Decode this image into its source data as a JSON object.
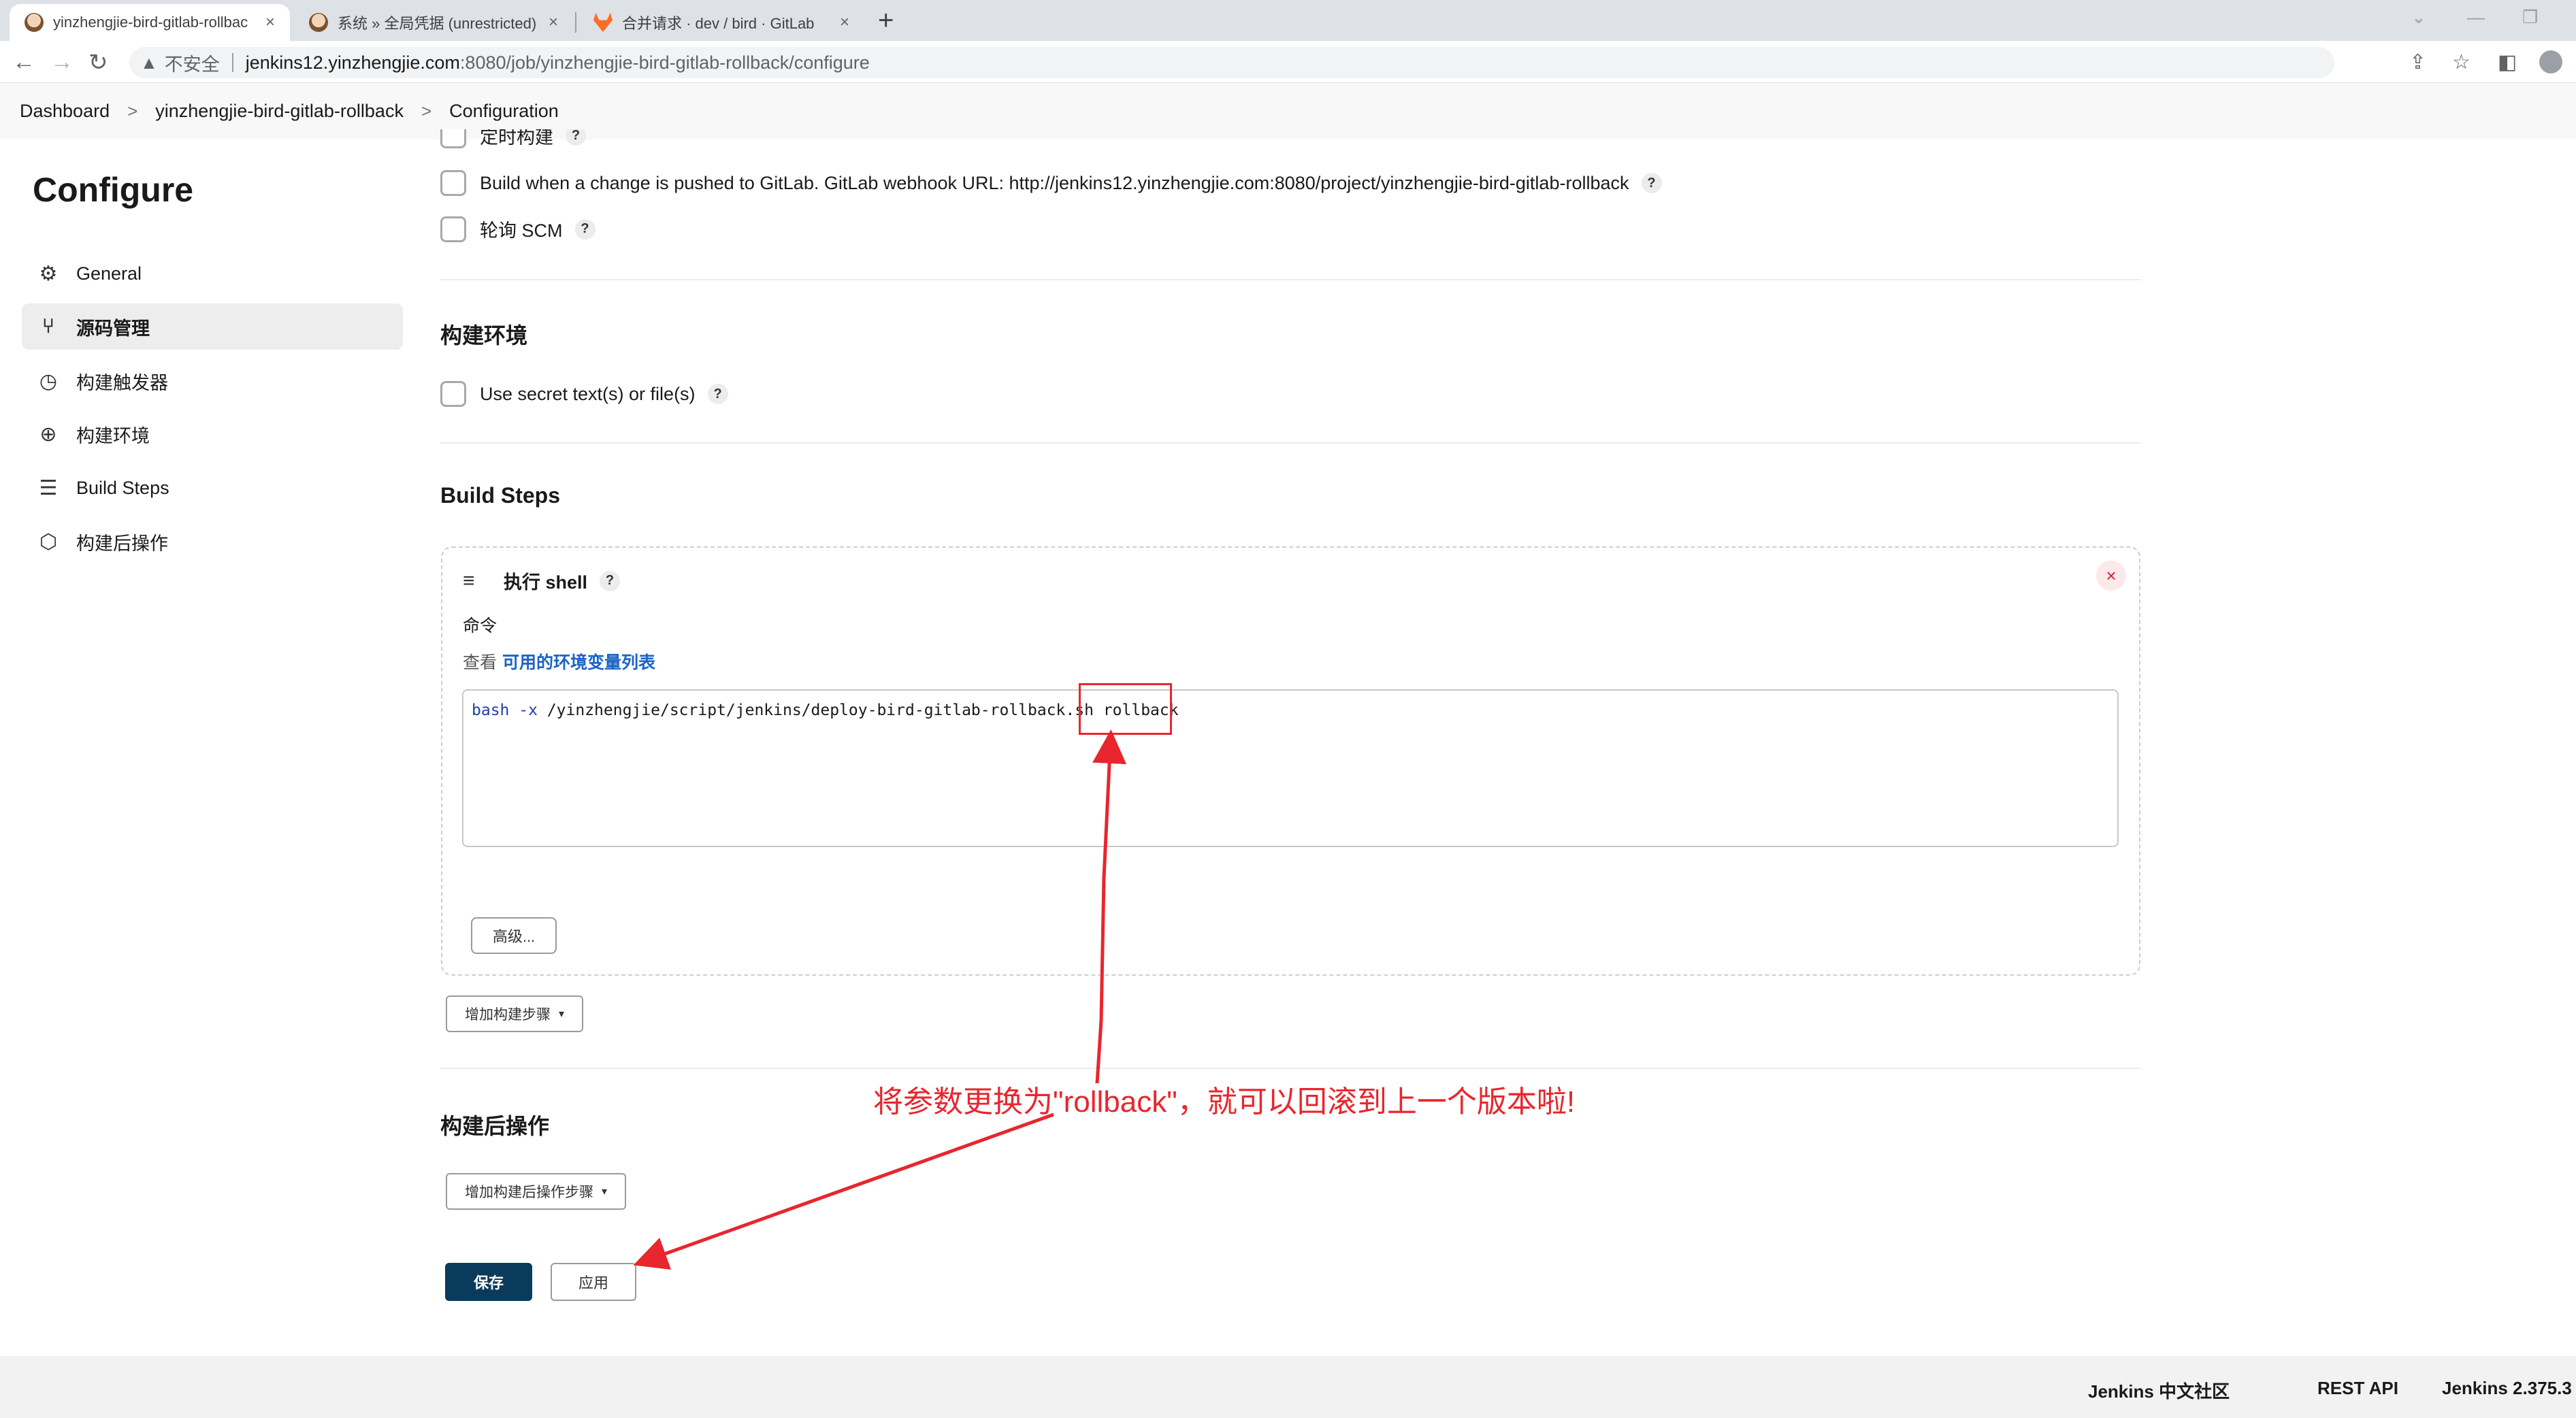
{
  "browser": {
    "tabs": [
      {
        "title": "yinzhengjie-bird-gitlab-rollbac",
        "favicon": "jenkins-icon"
      },
      {
        "title": "系统 » 全局凭据 (unrestricted) |",
        "favicon": "jenkins-icon"
      },
      {
        "title": "合并请求 · dev / bird · GitLab",
        "favicon": "gitlab-icon"
      }
    ],
    "new_tab": "+",
    "close_glyph": "×",
    "address": {
      "warning": "▲",
      "insecure_label": "不安全",
      "host": "jenkins12.yinzhengjie.com",
      "path": ":8080/job/yinzhengjie-bird-gitlab-rollback/configure"
    }
  },
  "breadcrumb": [
    "Dashboard",
    "yinzhengjie-bird-gitlab-rollback",
    "Configuration"
  ],
  "breadcrumb_sep": ">",
  "sidebar": {
    "title": "Configure",
    "items": [
      {
        "label": "General",
        "icon": "gear-icon",
        "glyph": "⚙"
      },
      {
        "label": "源码管理",
        "icon": "branch-icon",
        "glyph": "⑂"
      },
      {
        "label": "构建触发器",
        "icon": "clock-icon",
        "glyph": "◷"
      },
      {
        "label": "构建环境",
        "icon": "globe-icon",
        "glyph": "⊕"
      },
      {
        "label": "Build Steps",
        "icon": "list-icon",
        "glyph": "☰"
      },
      {
        "label": "构建后操作",
        "icon": "cube-icon",
        "glyph": "⬡"
      }
    ]
  },
  "triggers": {
    "partial_label": "定时构建",
    "gitlab_push": "Build when a change is pushed to GitLab. GitLab webhook URL: http://jenkins12.yinzhengjie.com:8080/project/yinzhengjie-bird-gitlab-rollback",
    "poll_scm": "轮询 SCM"
  },
  "help_glyph": "?",
  "build_env": {
    "title": "构建环境",
    "secret_text": "Use secret text(s) or file(s)"
  },
  "build_steps": {
    "title": "Build Steps",
    "step_title": "执行 shell",
    "handle_glyph": "≡",
    "close_glyph": "×",
    "command_label": "命令",
    "env_prefix": "查看",
    "env_link": "可用的环境变量列表",
    "command": {
      "bash": "bash",
      "flag": "-x",
      "script": "/yinzhengjie/script/jenkins/deploy-bird-gitlab-rollback.sh",
      "argument": "rollback"
    },
    "advanced": "高级...",
    "add_step": "增加构建步骤"
  },
  "post_build": {
    "title": "构建后操作",
    "add_step": "增加构建后操作步骤"
  },
  "dropdown_caret": "▾",
  "actions": {
    "save": "保存",
    "apply": "应用"
  },
  "annotation": {
    "text": "将参数更换为\"rollback\"，就可以回滚到上一个版本啦!",
    "color": "#e8262d"
  },
  "footer": {
    "community": "Jenkins 中文社区",
    "rest_api": "REST API",
    "version": "Jenkins 2.375.3"
  }
}
